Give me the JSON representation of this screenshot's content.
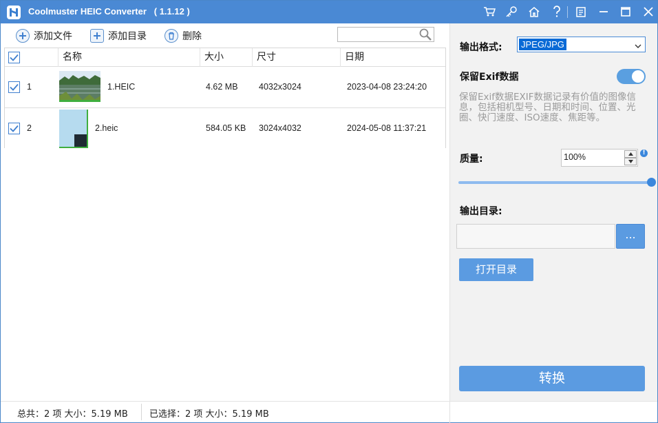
{
  "window": {
    "title": "Coolmuster HEIC Converter   ( 1.1.12 )"
  },
  "titlebar_buttons": [
    "cart-icon",
    "key-icon",
    "home-icon",
    "help-icon",
    "feedback-icon",
    "minimize-icon",
    "maximize-icon",
    "close-icon"
  ],
  "toolbar": {
    "add_file": "添加文件",
    "add_folder": "添加目录",
    "delete": "删除",
    "search_value": ""
  },
  "table": {
    "columns": [
      "名称",
      "大小",
      "尺寸",
      "日期"
    ],
    "header_checked": true,
    "rows": [
      {
        "checked": true,
        "index": "1",
        "name": "1.HEIC",
        "size": "4.62 MB",
        "dimensions": "4032x3024",
        "date": "2023-04-08 23:24:20"
      },
      {
        "checked": true,
        "index": "2",
        "name": "2.heic",
        "size": "584.05 KB",
        "dimensions": "3024x4032",
        "date": "2024-05-08 11:37:21"
      }
    ]
  },
  "panel": {
    "format_label": "输出格式:",
    "format_value": "JPEG/JPG",
    "exif_label": "保留Exif数据",
    "exif_enabled": true,
    "exif_desc": "保留Exif数据EXIF数据记录有价值的图像信息，包括相机型号、日期和时间、位置、光圈、快门速度、ISO速度、焦距等。",
    "quality_label": "质量:",
    "quality_value": "100%",
    "quality_level": 1.0,
    "info_badge": "!",
    "output_dir_label": "输出目录:",
    "output_dir_value": "",
    "browse_label": "...",
    "open_dir_label": "打开目录",
    "convert_label": "转换"
  },
  "status": {
    "total": "总共：2 项 大小：5.19 MB",
    "selected": "已选择：2 项 大小：5.19 MB"
  },
  "colors": {
    "accent": "#4a89d4",
    "button": "#5b9be1",
    "checkbox": "#3f7fcf"
  }
}
